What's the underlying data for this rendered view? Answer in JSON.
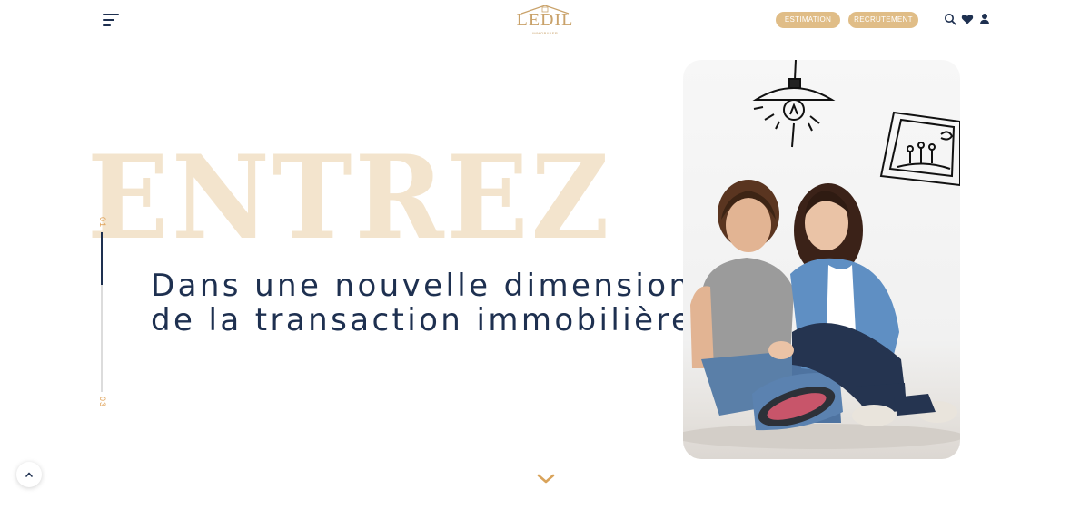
{
  "header": {
    "logo_text": "LEDIL",
    "logo_subtext": "IMMOBILIER",
    "buttons": {
      "estimation": "ESTIMATION",
      "recrutement": "RECRUTEMENT"
    },
    "icons": [
      "menu-icon",
      "search-icon",
      "heart-icon",
      "user-icon"
    ]
  },
  "hero": {
    "big_word": "ENTREZ",
    "subtitle_line1": "Dans une nouvelle dimension",
    "subtitle_line2": "de la transaction immobilière",
    "slide_current": "01",
    "slide_total": "03",
    "slide_progress": 0.33,
    "scroll_icon": "chevron-down-icon"
  },
  "back_to_top_icon": "chevron-up-icon",
  "colors": {
    "accent": "#e0bd87",
    "navy": "#1e3050",
    "big_word": "#f3e4cd",
    "number": "#e0a35a"
  }
}
